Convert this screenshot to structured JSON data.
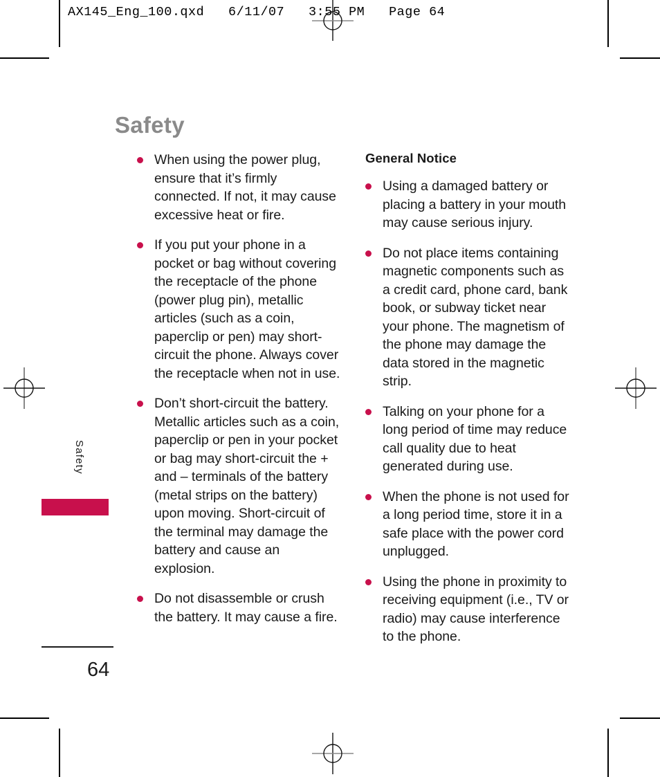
{
  "print_header": "AX145_Eng_100.qxd   6/11/07   3:55 PM   Page 64",
  "page": {
    "title": "Safety",
    "side_tab_label": "Safety",
    "folio": "64"
  },
  "colors": {
    "bullet": "#C8104C",
    "side_tab": "#C8104C",
    "title_gray": "#8A8A8A",
    "body_text": "#1A1A1A"
  },
  "columns": {
    "left": {
      "bullets": [
        "When using the power plug, ensure that it’s firmly connected. If not, it may cause excessive heat or fire.",
        "If you put your phone in a pocket or bag without covering the receptacle of the phone (power plug pin), metallic articles (such as a coin, paperclip or pen) may short-circuit the phone. Always cover the receptacle when not in use.",
        "Don’t short-circuit the battery. Metallic articles such as a coin, paperclip or pen in your pocket or bag may short-circuit the + and – terminals of the battery (metal strips on the battery) upon moving. Short-circuit of the terminal may damage the battery and cause an explosion.",
        "Do not disassemble or crush the battery. It may cause a fire."
      ]
    },
    "right": {
      "heading": "General Notice",
      "bullets": [
        "Using a damaged battery or placing a battery in your mouth may cause serious injury.",
        "Do not place items containing magnetic components such as a credit card, phone card, bank book, or subway ticket near your phone. The magnetism of the phone may damage the data stored in the magnetic strip.",
        "Talking on your phone for a long period of time may reduce call quality due to heat generated during use.",
        "When the phone is not used for a long period time, store it in a safe place with the power cord unplugged.",
        "Using the phone in proximity to receiving equipment (i.e., TV or radio) may cause interference to the phone."
      ]
    }
  },
  "marks": {
    "registration_icon": "registration-target-icon",
    "crop_icon": "crop-mark-icon"
  }
}
